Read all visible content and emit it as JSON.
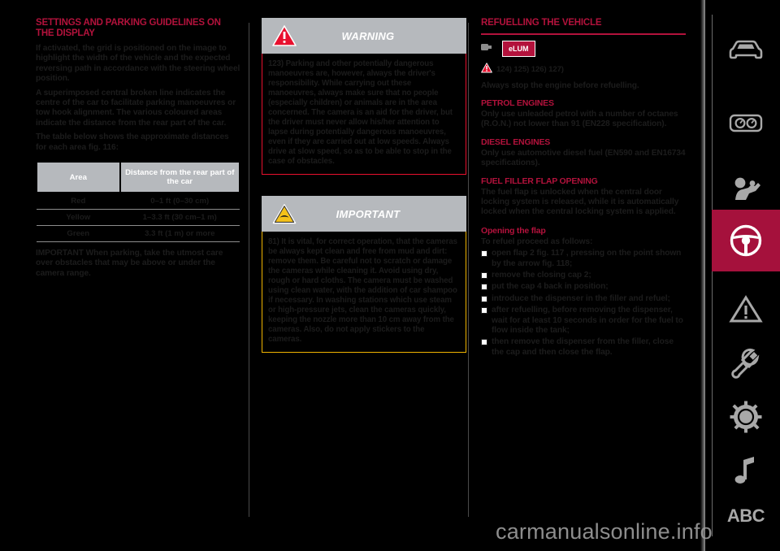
{
  "watermark": "carmanualsonline.info",
  "column1": {
    "title": "SETTINGS AND PARKING GUIDELINES ON THE DISPLAY",
    "paragraphs": [
      "If activated, the grid is positioned on the image to highlight the width of the vehicle and the expected reversing path in accordance with the steering wheel position.",
      "A superimposed central broken line indicates the centre of the car to facilitate parking manoeuvres or tow hook alignment. The various coloured areas indicate the distance from the rear part of the car.",
      "The table below shows the approximate distances for each area fig. 116:"
    ],
    "table": {
      "headers": [
        "Area",
        "Distance from the rear part of the car"
      ],
      "rows": [
        [
          "Red",
          "0–1 ft (0–30 cm)"
        ],
        [
          "Yellow",
          "1–3.3 ft (30 cm–1 m)"
        ],
        [
          "Green",
          "3.3 ft (1 m) or more"
        ]
      ]
    },
    "footnote": "IMPORTANT When parking, take the utmost care over obstacles that may be above or under the camera range."
  },
  "column2": {
    "warning": {
      "icon": "warning-triangle-red-icon",
      "title": "WARNING",
      "text": "123) Parking and other potentially dangerous manoeuvres are, however, always the driver's responsibility. While carrying out these manoeuvres, always make sure that no people (especially children) or animals are in the area concerned. The camera is an aid for the driver, but the driver must never allow his/her attention to lapse during potentially dangerous manoeuvres, even if they are carried out at low speeds. Always drive at slow speed, so as to be able to stop in the case of obstacles."
    },
    "important": {
      "icon": "important-triangle-yellow-icon",
      "title": "IMPORTANT",
      "text": "81) It is vital, for correct operation, that the cameras be always kept clean and free from mud and dirt: remove them. Be careful not to scratch or damage the cameras while cleaning it. Avoid using dry, rough or hard cloths. The camera must be washed using clean water, with the addition of car shampoo if necessary. In washing stations which use steam or high-pressure jets, clean the cameras quickly, keeping the nozzle more than 10 cm away from the cameras. Also, do not apply stickers to the cameras."
    }
  },
  "column3": {
    "title": "REFUELLING THE VEHICLE",
    "elum": {
      "hand_icon": "pointing-hand-icon",
      "badge": "eLUM"
    },
    "mini_warning": {
      "icon": "warning-triangle-red-small-icon",
      "label": "124) 125) 126) 127)"
    },
    "intro": "Always stop the engine before refuelling.",
    "sections": [
      {
        "heading": "PETROL ENGINES",
        "text": "Only use unleaded petrol with a number of octanes (R.O.N.) not lower than 91 (EN228 specification)."
      },
      {
        "heading": "DIESEL ENGINES",
        "text": "Only use automotive diesel fuel (EN590 and EN16734 specifications)."
      },
      {
        "heading": "FUEL FILLER FLAP OPENING",
        "text": "The fuel flap is unlocked when the central door locking system is released, while it is automatically locked when the central locking system is applied."
      }
    ],
    "procedure": {
      "heading": "Opening the flap",
      "intro": "To refuel proceed as follows:",
      "steps": [
        "open flap 2 fig. 117 , pressing on the point shown by the arrow fig. 118;",
        "remove the closing cap 2;",
        "put the cap 4 back in position;",
        "introduce the dispenser in the filler and refuel;",
        "after refuelling, before removing the dispenser, wait for at least 10 seconds in order for the fuel to flow inside the tank;",
        "then remove the dispenser from the filler, close the cap and then close the flap."
      ]
    }
  },
  "sidebar": {
    "items": [
      {
        "icon": "car-front-icon",
        "name": "vehicle",
        "active": false
      },
      {
        "icon": "dashboard-icon",
        "name": "dashboard",
        "active": false
      },
      {
        "icon": "airbag-safety-icon",
        "name": "safety",
        "active": false
      },
      {
        "icon": "steering-wheel-icon",
        "name": "driving",
        "active": true
      },
      {
        "icon": "warning-triangle-icon",
        "name": "emergency",
        "active": false
      },
      {
        "icon": "wrench-icon",
        "name": "maintenance",
        "active": false
      },
      {
        "icon": "gear-info-icon",
        "name": "technical",
        "active": false
      },
      {
        "icon": "music-note-icon",
        "name": "multimedia",
        "active": false
      },
      {
        "icon": "abc-index-icon",
        "name": "index",
        "active": false,
        "text": "ABC"
      }
    ]
  },
  "colors": {
    "brand_red": "#b3123c",
    "warning_red": "#e8102e",
    "important_yellow": "#f0b400",
    "table_header_gray": "#b6b9bd"
  }
}
